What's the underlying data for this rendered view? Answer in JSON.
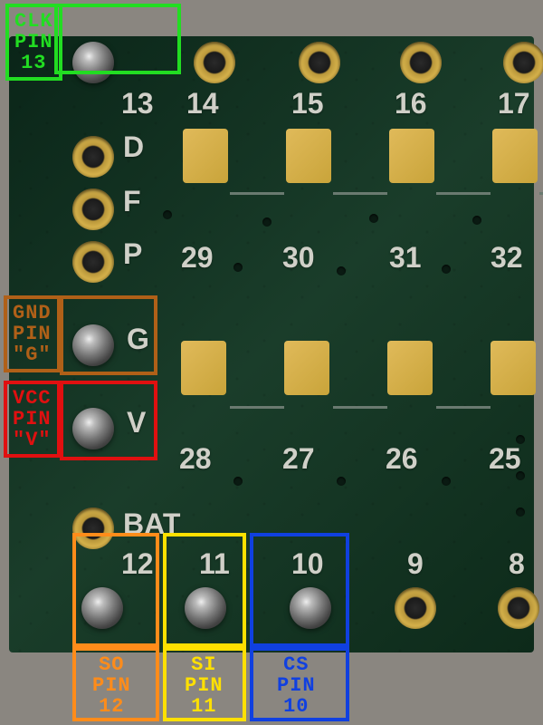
{
  "annotations": {
    "clk": {
      "lines": [
        "CLK",
        "PIN",
        "13"
      ],
      "color": "#22dd22"
    },
    "gnd": {
      "lines": [
        "GND",
        "PIN",
        "\"G\""
      ],
      "color": "#b06018"
    },
    "vcc": {
      "lines": [
        "VCC",
        "PIN",
        "\"V\""
      ],
      "color": "#e01010"
    },
    "so": {
      "lines": [
        "SO",
        "PIN",
        "12"
      ],
      "color": "#ff8c1a"
    },
    "si": {
      "lines": [
        "SI",
        "PIN",
        "11"
      ],
      "color": "#ffe000"
    },
    "cs": {
      "lines": [
        "CS",
        "PIN",
        "10"
      ],
      "color": "#1040e0"
    }
  },
  "silkscreen": {
    "top_row": [
      "13",
      "14",
      "15",
      "16",
      "17"
    ],
    "letters": {
      "D": "D",
      "F": "F",
      "P": "P",
      "G": "G",
      "V": "V",
      "BAT": "BAT"
    },
    "mid_row": [
      "29",
      "30",
      "31",
      "32"
    ],
    "lower_mid": [
      "28",
      "27",
      "26",
      "25"
    ],
    "bottom_row": [
      "12",
      "11",
      "10",
      "9",
      "8"
    ]
  }
}
